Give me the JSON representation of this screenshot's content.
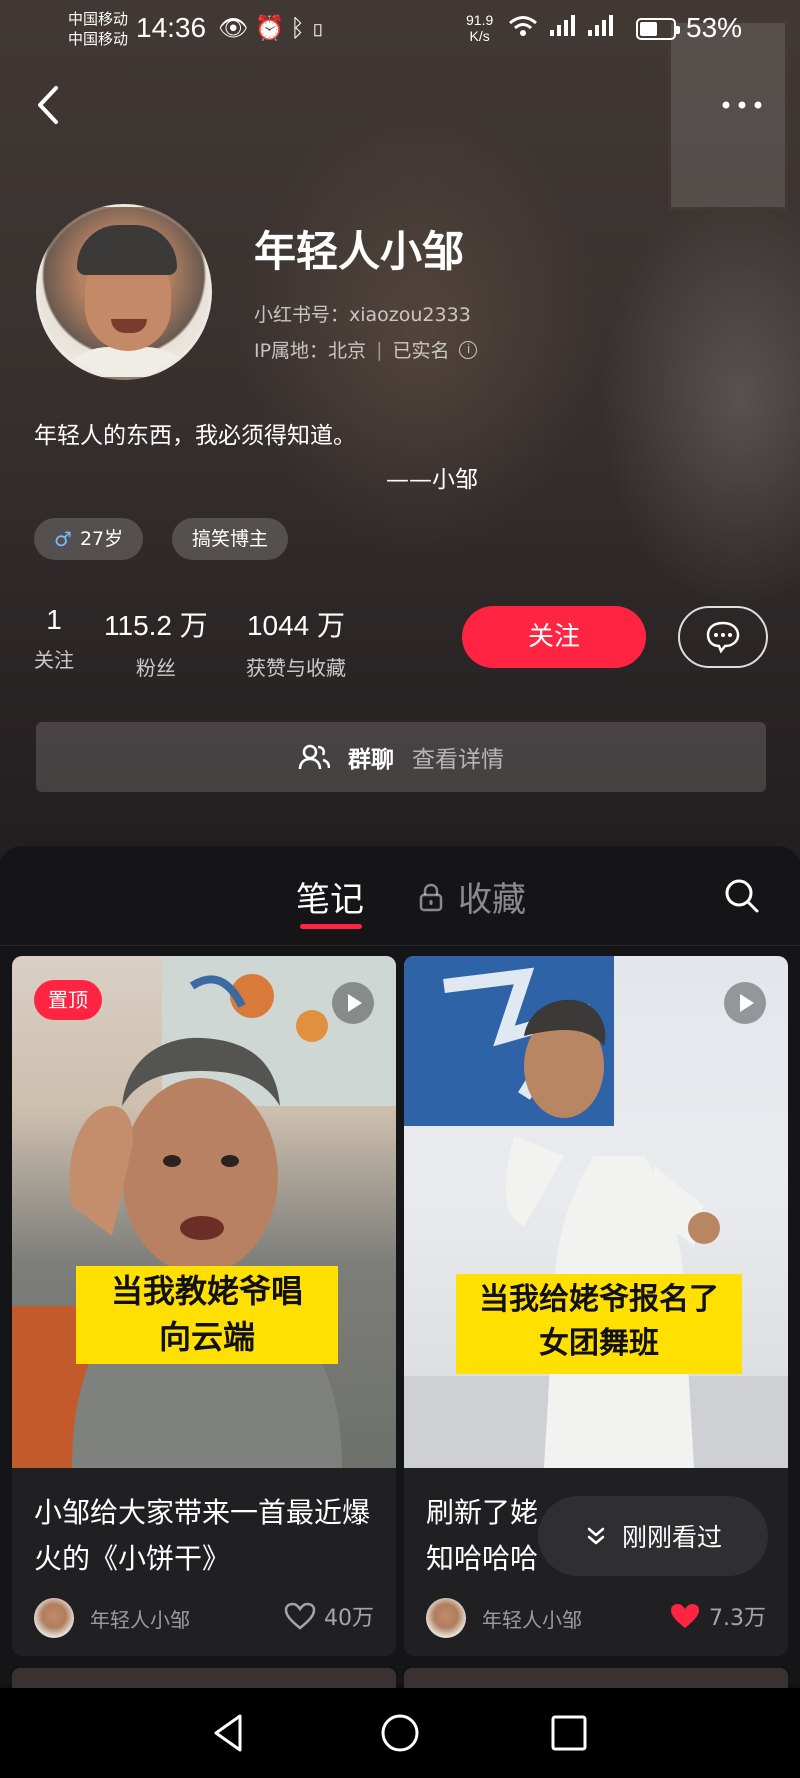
{
  "status_bar": {
    "carrier_1": "中国移动",
    "carrier_2": "中国移动",
    "time": "14:36",
    "net_speed_value": "91.9",
    "net_speed_unit": "K/s",
    "battery_percent": "53%",
    "battery_level": 0.53
  },
  "profile": {
    "name": "年轻人小邹",
    "red_id": "小红书号：xiaozou2333",
    "ip_label": "IP属地：北京",
    "verified": "已实名",
    "bio": "年轻人的东西，我必须得知道。",
    "bio_signature": "——小邹",
    "tags": {
      "age": "27岁",
      "role": "搞笑博主"
    },
    "stats": {
      "following_value": "1",
      "following_label": "关注",
      "fans_value": "115.2 万",
      "fans_label": "粉丝",
      "likes_value": "1044 万",
      "likes_label": "获赞与收藏"
    },
    "follow_button": "关注"
  },
  "group_chat": {
    "label": "群聊",
    "detail": "查看详情"
  },
  "tabs": {
    "notes": "笔记",
    "favorites": "收藏"
  },
  "cards": [
    {
      "badge": "置顶",
      "cover_caption_line1": "当我教姥爷唱",
      "cover_caption_line2": "向云端",
      "title": "小邹给大家带来一首最近爆火的《小饼干》",
      "author": "年轻人小邹",
      "likes": "40万",
      "liked": false
    },
    {
      "cover_caption_line1": "当我给姥爷报名了",
      "cover_caption_line2": "女团舞班",
      "title_line1": "刷新了姥",
      "title_line2": "知哈哈哈",
      "author": "年轻人小邹",
      "likes": "7.3万",
      "liked": true
    }
  ],
  "recently_viewed": "刚刚看过",
  "colors": {
    "accent": "#ff2442",
    "caption_yellow": "#ffe000",
    "content_bg": "#151517"
  }
}
